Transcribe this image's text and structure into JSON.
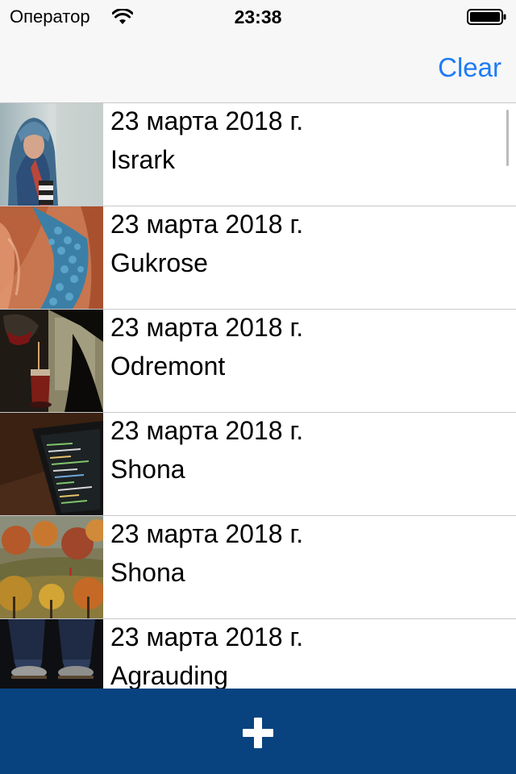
{
  "status_bar": {
    "carrier": "Оператор",
    "time": "23:38",
    "wifi_icon": "wifi-icon",
    "battery_icon": "battery-icon"
  },
  "nav_bar": {
    "clear_label": "Clear"
  },
  "list": {
    "items": [
      {
        "date": "23 марта 2018 г.",
        "name": "Isrark",
        "thumbnail": "woman-in-headscarf-photo"
      },
      {
        "date": "23 марта 2018 г.",
        "name": "Gukrose",
        "thumbnail": "fabric-with-blue-beads-photo"
      },
      {
        "date": "23 марта 2018 г.",
        "name": "Odremont",
        "thumbnail": "pouring-tea-photo"
      },
      {
        "date": "23 марта 2018 г.",
        "name": "Shona",
        "thumbnail": "laptop-code-photo"
      },
      {
        "date": "23 марта 2018 г.",
        "name": "Shona",
        "thumbnail": "autumn-trees-photo"
      },
      {
        "date": "23 марта 2018 г.",
        "name": "Agrauding",
        "thumbnail": "jeans-and-shoes-photo"
      }
    ]
  },
  "bottom_bar": {
    "add_icon": "plus-icon"
  },
  "colors": {
    "accent": "#1e7bf6",
    "bottom_bar": "#08437f",
    "separator": "#c8c7cc",
    "bar_background": "#f7f7f7"
  }
}
